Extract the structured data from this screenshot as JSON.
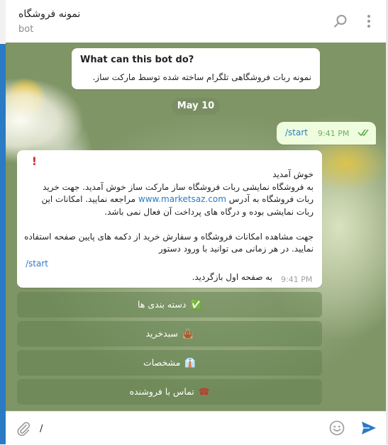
{
  "header": {
    "title": "نمونه فروشگاه",
    "subtitle": "bot",
    "icons": [
      "search-icon",
      "more-vertical-icon"
    ]
  },
  "info_card": {
    "heading": "What can this bot do?",
    "text": "نمونه ربات فروشگاهی تلگرام ساخته شده توسط مارکت ساز."
  },
  "date_separator": "May 10",
  "outgoing": {
    "text": "/start",
    "time": "9:41 PM",
    "status_icon": "double-check-icon"
  },
  "incoming": {
    "icon": "exclamation-icon",
    "greeting": "خوش آمدید",
    "line1": "به فروشگاه نمایشی ربات فروشگاه ساز مارکت ساز خوش آمدید. جهت خرید ربات فروشگاه به آدرس ",
    "link": "www.marketsaz.com",
    "line1_end": " مراجعه نمایید. امکانات این ربات نمایشی بوده و درگاه های پرداخت آن فعال نمی باشد.",
    "paragraph2": "جهت مشاهده امکانات فروشگاه و سفارش خرید از دکمه های پایین صفحه استفاده نمایید. در هر زمانی می توانید با ورود دستور",
    "command": "/start",
    "last_line": "به صفحه اول بازگردید.",
    "time": "9:41 PM"
  },
  "keyboard": [
    {
      "emoji": "✅",
      "label": "دسته بندی ها"
    },
    {
      "emoji": "👜",
      "label": "سبدخرید"
    },
    {
      "emoji": "👔",
      "label": "مشخصات"
    },
    {
      "emoji": "☎",
      "label": "تماس با فروشنده"
    }
  ],
  "composer": {
    "value": "/",
    "icons": [
      "attach-icon",
      "emoji-icon",
      "send-icon"
    ],
    "accent": "#2a7bc4"
  }
}
